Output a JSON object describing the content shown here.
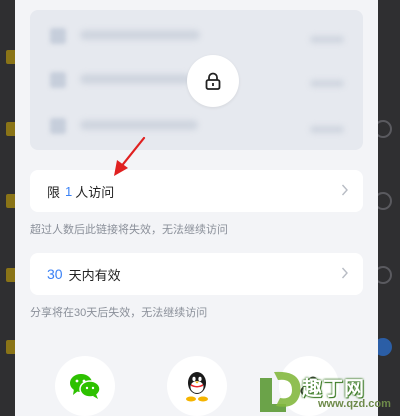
{
  "share_sheet": {
    "locked_preview": {
      "icon": "lock-icon"
    },
    "visitor_limit": {
      "prefix": "限",
      "value": "1",
      "suffix": "人访问",
      "hint": "超过人数后此链接将失效，无法继续访问"
    },
    "validity": {
      "value": "30",
      "suffix": "天内有效",
      "hint": "分享将在30天后失效，无法继续访问"
    },
    "share_targets": [
      {
        "icon": "wechat-icon"
      },
      {
        "icon": "qq-icon"
      },
      {
        "icon": "link-icon"
      }
    ]
  },
  "accent_color": "#3b82f6",
  "annotation_color": "#e02020",
  "watermark": {
    "text": "趣丁网",
    "url": "www.qzd.com"
  }
}
